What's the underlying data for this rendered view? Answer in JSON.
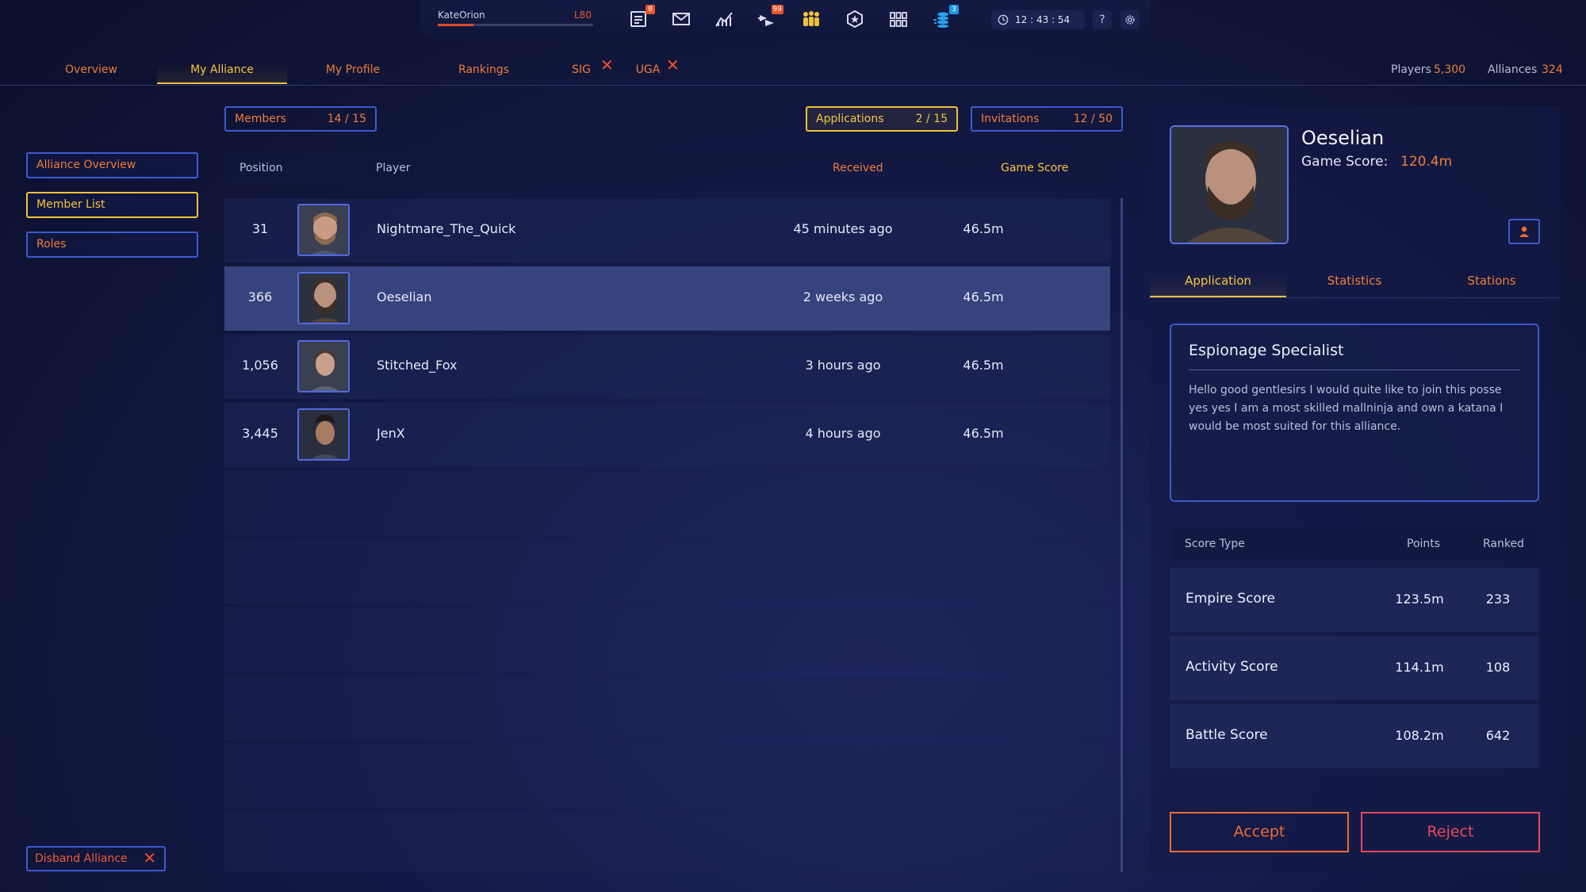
{
  "topbar": {
    "username": "KateOrion",
    "level": "L80",
    "xp_progress": 0.23,
    "icons": [
      {
        "name": "reports-icon",
        "badge": "8",
        "badge_color": "#e8542c"
      },
      {
        "name": "mail-icon",
        "badge": "",
        "badge_color": ""
      },
      {
        "name": "stats-icon",
        "badge": "",
        "badge_color": ""
      },
      {
        "name": "fleet-icon",
        "badge": "99",
        "badge_color": "#e8542c"
      },
      {
        "name": "alliance-icon",
        "badge": "",
        "badge_color": ""
      },
      {
        "name": "badge-icon",
        "badge": "",
        "badge_color": ""
      },
      {
        "name": "grid-icon",
        "badge": "",
        "badge_color": ""
      },
      {
        "name": "resources-icon",
        "badge": "3",
        "badge_color": "#1e9be6"
      }
    ],
    "clock": "12 : 43 : 54",
    "help_label": "?",
    "settings_icon": "gear-icon"
  },
  "nav": {
    "tabs": [
      {
        "label": "Overview",
        "active": false
      },
      {
        "label": "My Alliance",
        "active": true
      },
      {
        "label": "My Profile",
        "active": false
      },
      {
        "label": "Rankings",
        "active": false
      },
      {
        "label": "SIG",
        "active": false,
        "closable": true
      },
      {
        "label": "UGA",
        "active": false,
        "closable": true
      }
    ],
    "players_label": "Players",
    "players_value": "5,300",
    "alliances_label": "Alliances",
    "alliances_value": "324"
  },
  "sidebar": {
    "items": [
      {
        "label": "Alliance Overview",
        "active": false
      },
      {
        "label": "Member List",
        "active": true
      },
      {
        "label": "Roles",
        "active": false
      }
    ],
    "disband_label": "Disband Alliance"
  },
  "counters": {
    "members": {
      "label": "Members",
      "value": "14 / 15"
    },
    "applications": {
      "label": "Applications",
      "value": "2 / 15"
    },
    "invitations": {
      "label": "Invitations",
      "value": "12 / 50"
    }
  },
  "table": {
    "headers": {
      "position": "Position",
      "player": "Player",
      "received": "Received",
      "game_score": "Game Score"
    },
    "rows": [
      {
        "position": "31",
        "player": "Nightmare_The_Quick",
        "received": "45 minutes ago",
        "score": "46.5m"
      },
      {
        "position": "366",
        "player": "Oeselian",
        "received": "2 weeks ago",
        "score": "46.5m"
      },
      {
        "position": "1,056",
        "player": "Stitched_Fox",
        "received": "3 hours ago",
        "score": "46.5m"
      },
      {
        "position": "3,445",
        "player": "JenX",
        "received": "4 hours ago",
        "score": "46.5m"
      }
    ]
  },
  "detail": {
    "name": "Oeselian",
    "game_score_label": "Game Score:",
    "game_score_value": "120.4m",
    "tabs": [
      {
        "label": "Application",
        "active": true
      },
      {
        "label": "Statistics",
        "active": false
      },
      {
        "label": "Stations",
        "active": false
      }
    ],
    "application_title": "Espionage Specialist",
    "application_message": "Hello good gentlesirs I would quite like to join this posse yes yes I am a most skilled mallninja and own a katana I would be most suited for this alliance.",
    "score_headers": {
      "type": "Score Type",
      "points": "Points",
      "ranked": "Ranked"
    },
    "scores": [
      {
        "type": "Empire Score",
        "points": "123.5m",
        "ranked": "233"
      },
      {
        "type": "Activity Score",
        "points": "114.1m",
        "ranked": "108"
      },
      {
        "type": "Battle Score",
        "points": "108.2m",
        "ranked": "642"
      }
    ],
    "accept_label": "Accept",
    "reject_label": "Reject"
  },
  "colors": {
    "accent_orange": "#ef7d38",
    "accent_gold": "#f6c640",
    "border_blue": "#3c5bd0"
  }
}
